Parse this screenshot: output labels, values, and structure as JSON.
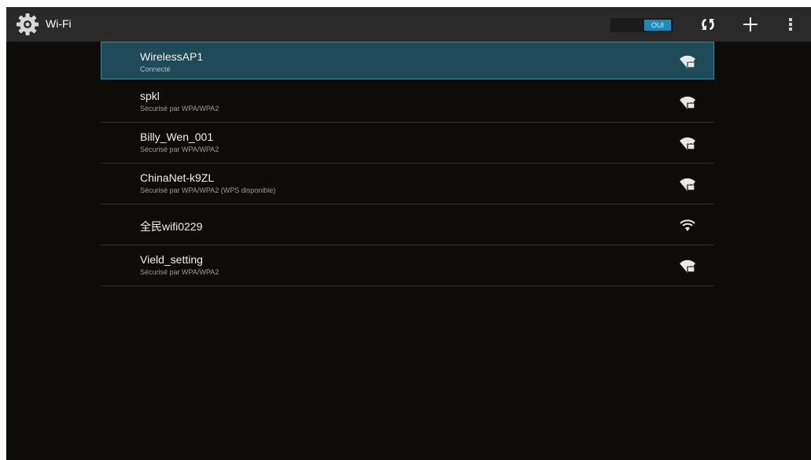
{
  "header": {
    "title": "Wi-Fi",
    "toggle_label": "OUI"
  },
  "networks": [
    {
      "ssid": "WirelessAP1",
      "status": "Connecté",
      "secured": true,
      "selected": true
    },
    {
      "ssid": "spkl",
      "status": "Sécurisé par WPA/WPA2",
      "secured": true,
      "selected": false
    },
    {
      "ssid": "Billy_Wen_001",
      "status": "Sécurisé par WPA/WPA2",
      "secured": true,
      "selected": false
    },
    {
      "ssid": "ChinaNet-k9ZL",
      "status": "Sécurisé par WPA/WPA2 (WPS disponible)",
      "secured": true,
      "selected": false
    },
    {
      "ssid": "全民wifi0229",
      "status": "",
      "secured": false,
      "selected": false
    },
    {
      "ssid": "Vield_setting",
      "status": "Sécurisé par WPA/WPA2",
      "secured": true,
      "selected": false
    }
  ],
  "icons": {
    "app": "gear-icon",
    "scan": "scan-icon",
    "add": "plus-icon",
    "menu": "overflow-menu-icon",
    "secured_signal": "wifi-lock-icon",
    "open_signal": "wifi-icon"
  },
  "colors": {
    "accent": "#1c89bf",
    "selected_row": "#1f4a57",
    "background": "#0d0c09",
    "actionbar": "#2a2a2a"
  }
}
